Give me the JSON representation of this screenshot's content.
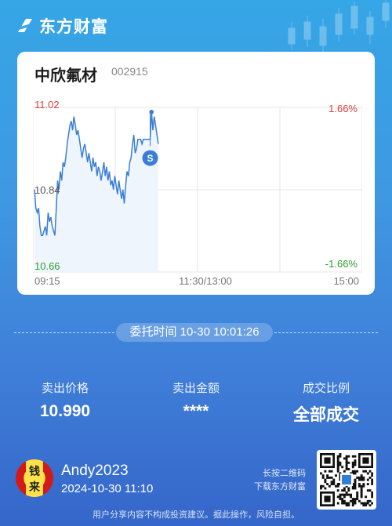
{
  "brand": {
    "name": "东方财富"
  },
  "stock": {
    "name": "中欣氟材",
    "code": "002915"
  },
  "chart_data": {
    "type": "line",
    "y_labels": {
      "top": "11.02",
      "mid": "10.84",
      "bottom": "10.66"
    },
    "pct_labels": {
      "top": "1.66%",
      "bottom": "-1.66%"
    },
    "x_labels": {
      "start": "09:15",
      "mid": "11:30/13:00",
      "end": "15:00"
    },
    "ylim": [
      10.66,
      11.02
    ],
    "reference_price": 10.84,
    "price_color": "#3b7ed6",
    "up_color": "#e03b3b",
    "down_color": "#2f9d2f",
    "series": [
      {
        "values": [
          10.84,
          10.8,
          10.79,
          10.8,
          10.76,
          10.74,
          10.74,
          10.75,
          10.76,
          10.74,
          10.79,
          10.77,
          10.78,
          10.76,
          10.75,
          10.74,
          10.8,
          10.86,
          10.84,
          10.88,
          10.86,
          10.9,
          10.89,
          10.91,
          10.94,
          10.96,
          10.98,
          10.99,
          10.97,
          11.0,
          10.98,
          10.96,
          10.97,
          10.95,
          10.93,
          10.91,
          10.93,
          10.94,
          10.92,
          10.9,
          10.92,
          10.9,
          10.88,
          10.91,
          10.89,
          10.9,
          10.87,
          10.89,
          10.88,
          10.86,
          10.88,
          10.9,
          10.87,
          10.89,
          10.86,
          10.88,
          10.85,
          10.86,
          10.84,
          10.87,
          10.85,
          10.83,
          10.86,
          10.84,
          10.82,
          10.84,
          10.81,
          10.85,
          10.88,
          10.87,
          10.9,
          10.91,
          10.94,
          10.96,
          10.92,
          10.93,
          10.95,
          10.95,
          10.95,
          10.94,
          10.95,
          10.95,
          10.95,
          10.95,
          10.95,
          10.95,
          11.01,
          10.97,
          11.0,
          10.98,
          10.96,
          10.94
        ]
      }
    ],
    "signal": {
      "label": "S",
      "index": 85,
      "value": 10.935
    },
    "peak_dot_index": 86
  },
  "order": {
    "time_label": "委托时间 10-30 10:01:26"
  },
  "stats": [
    {
      "label": "卖出价格",
      "value": "10.990"
    },
    {
      "label": "卖出金额",
      "value": "****"
    },
    {
      "label": "成交比例",
      "value": "全部成交"
    }
  ],
  "user": {
    "name": "Andy2023",
    "time": "2024-10-30 11:10",
    "avatar_chars": [
      "钱",
      "来"
    ]
  },
  "qr": {
    "hint_line1": "长按二维码",
    "hint_line2": "下载东方财富"
  },
  "footer": {
    "disclaimer": "用户分享内容不构成投资建议。据此操作，风险自担。"
  }
}
